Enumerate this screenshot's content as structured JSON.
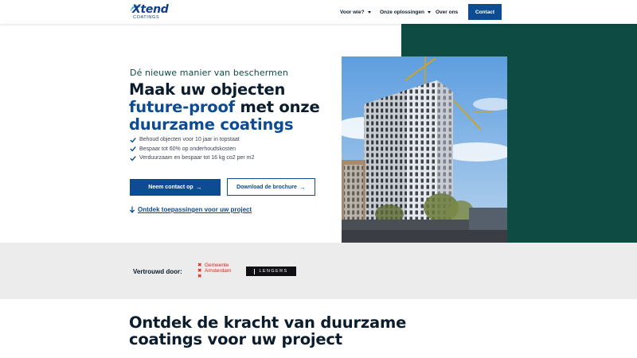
{
  "header": {
    "logo_text": "Xtend",
    "logo_sub": "COATINGS",
    "nav": [
      {
        "label": "Voor wie?",
        "has_dropdown": true
      },
      {
        "label": "Onze oplossingen",
        "has_dropdown": true
      },
      {
        "label": "Over ons",
        "has_dropdown": false
      }
    ],
    "contact_label": "Contact"
  },
  "hero": {
    "eyebrow": "Dé nieuwe manier van beschermen",
    "headline": {
      "line1": "Maak uw objecten",
      "line2_highlight": "future-proof",
      "line2_rest": " met onze",
      "line3_highlight": "duurzame coatings"
    },
    "benefits": [
      "Behoud objecten voor 10 jaar in topstaat",
      "Bespaar tot 60% op onderhoudskosten",
      "Verduurzaam en bespaar tot 16 kg co2 per m2"
    ],
    "primary_cta": "Neem contact op",
    "secondary_cta": "Download de brochure",
    "explore_link": "Ontdek toepassingen voor uw project",
    "image_icon": "building-photo"
  },
  "trusted": {
    "label": "Vertrouwd door:",
    "logos": {
      "amsterdam_line1": "Gemeente",
      "amsterdam_line2": "Amsterdam",
      "lengers": "LENGERS"
    }
  },
  "section": {
    "title_line1": "Ontdek de kracht van duurzame",
    "title_line2": "coatings voor uw project"
  },
  "colors": {
    "brand_blue": "#0d4c92",
    "dark_green": "#0e4b43",
    "amsterdam_red": "#e2231a"
  }
}
